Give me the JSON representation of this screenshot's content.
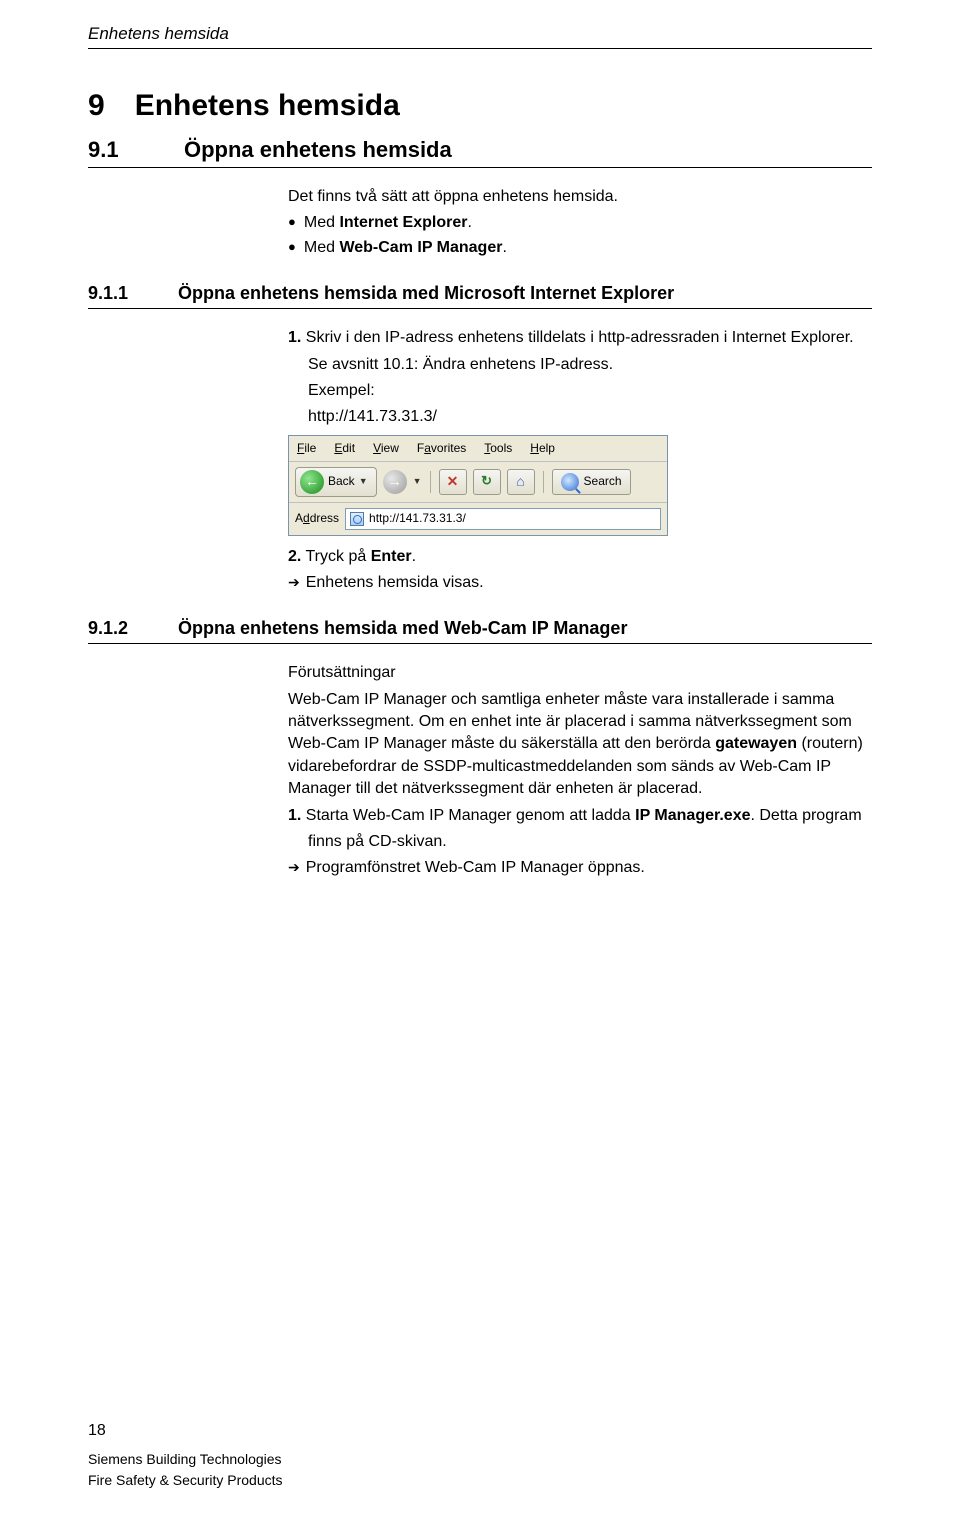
{
  "header": {
    "title": "Enhetens hemsida"
  },
  "h1": {
    "num": "9",
    "text": "Enhetens hemsida"
  },
  "h2": {
    "num": "9.1",
    "text": "Öppna enhetens hemsida"
  },
  "intro": {
    "line1": "Det finns två sätt att öppna enhetens hemsida.",
    "bullet1_pre": "Med ",
    "bullet1_bold": "Internet Explorer",
    "bullet1_post": ".",
    "bullet2_pre": "Med ",
    "bullet2_bold": "Web-Cam IP Manager",
    "bullet2_post": "."
  },
  "h3a": {
    "num": "9.1.1",
    "text": "Öppna enhetens hemsida med Microsoft Internet Explorer"
  },
  "sec1": {
    "step1_num": "1.",
    "step1_text": " Skriv i den IP-adress enhetens tilldelats i http-adressraden i Internet Explorer.",
    "step1_note": "Se avsnitt 10.1: Ändra enhetens IP-adress.",
    "example_label": "Exempel:",
    "example_url": "http://141.73.31.3/",
    "step2_num": "2.",
    "step2_pre": " Tryck på ",
    "step2_bold": "Enter",
    "step2_post": ".",
    "result": "Enhetens hemsida visas."
  },
  "ie": {
    "menu": {
      "file": "File",
      "edit": "Edit",
      "view": "View",
      "favorites": "Favorites",
      "tools": "Tools",
      "help": "Help"
    },
    "back": "Back",
    "search": "Search",
    "address_label": "Address",
    "address_value": "http://141.73.31.3/"
  },
  "h3b": {
    "num": "9.1.2",
    "text": "Öppna enhetens hemsida med Web-Cam IP Manager"
  },
  "sec2": {
    "prereq_label": "Förutsättningar",
    "body_pre": "Web-Cam IP Manager och samtliga enheter måste vara installerade i samma nätverkssegment. Om en enhet inte är placerad i samma nätverkssegment som Web-Cam IP Manager måste du säkerställa att den berörda ",
    "body_bold": "gatewayen",
    "body_post": " (routern) vidarebefordrar de SSDP-multicastmeddelanden som sänds av Web-Cam IP Manager till det nätverkssegment där enheten är placerad.",
    "step1_num": "1.",
    "step1_pre": " Starta Web-Cam IP Manager genom att ladda ",
    "step1_bold": "IP Manager.exe",
    "step1_post": ". Detta program",
    "step1_line2": "finns på CD-skivan.",
    "result": "Programfönstret Web-Cam IP Manager öppnas."
  },
  "footer": {
    "pagenum": "18",
    "line1": "Siemens Building Technologies",
    "line2": "Fire Safety & Security Products"
  }
}
